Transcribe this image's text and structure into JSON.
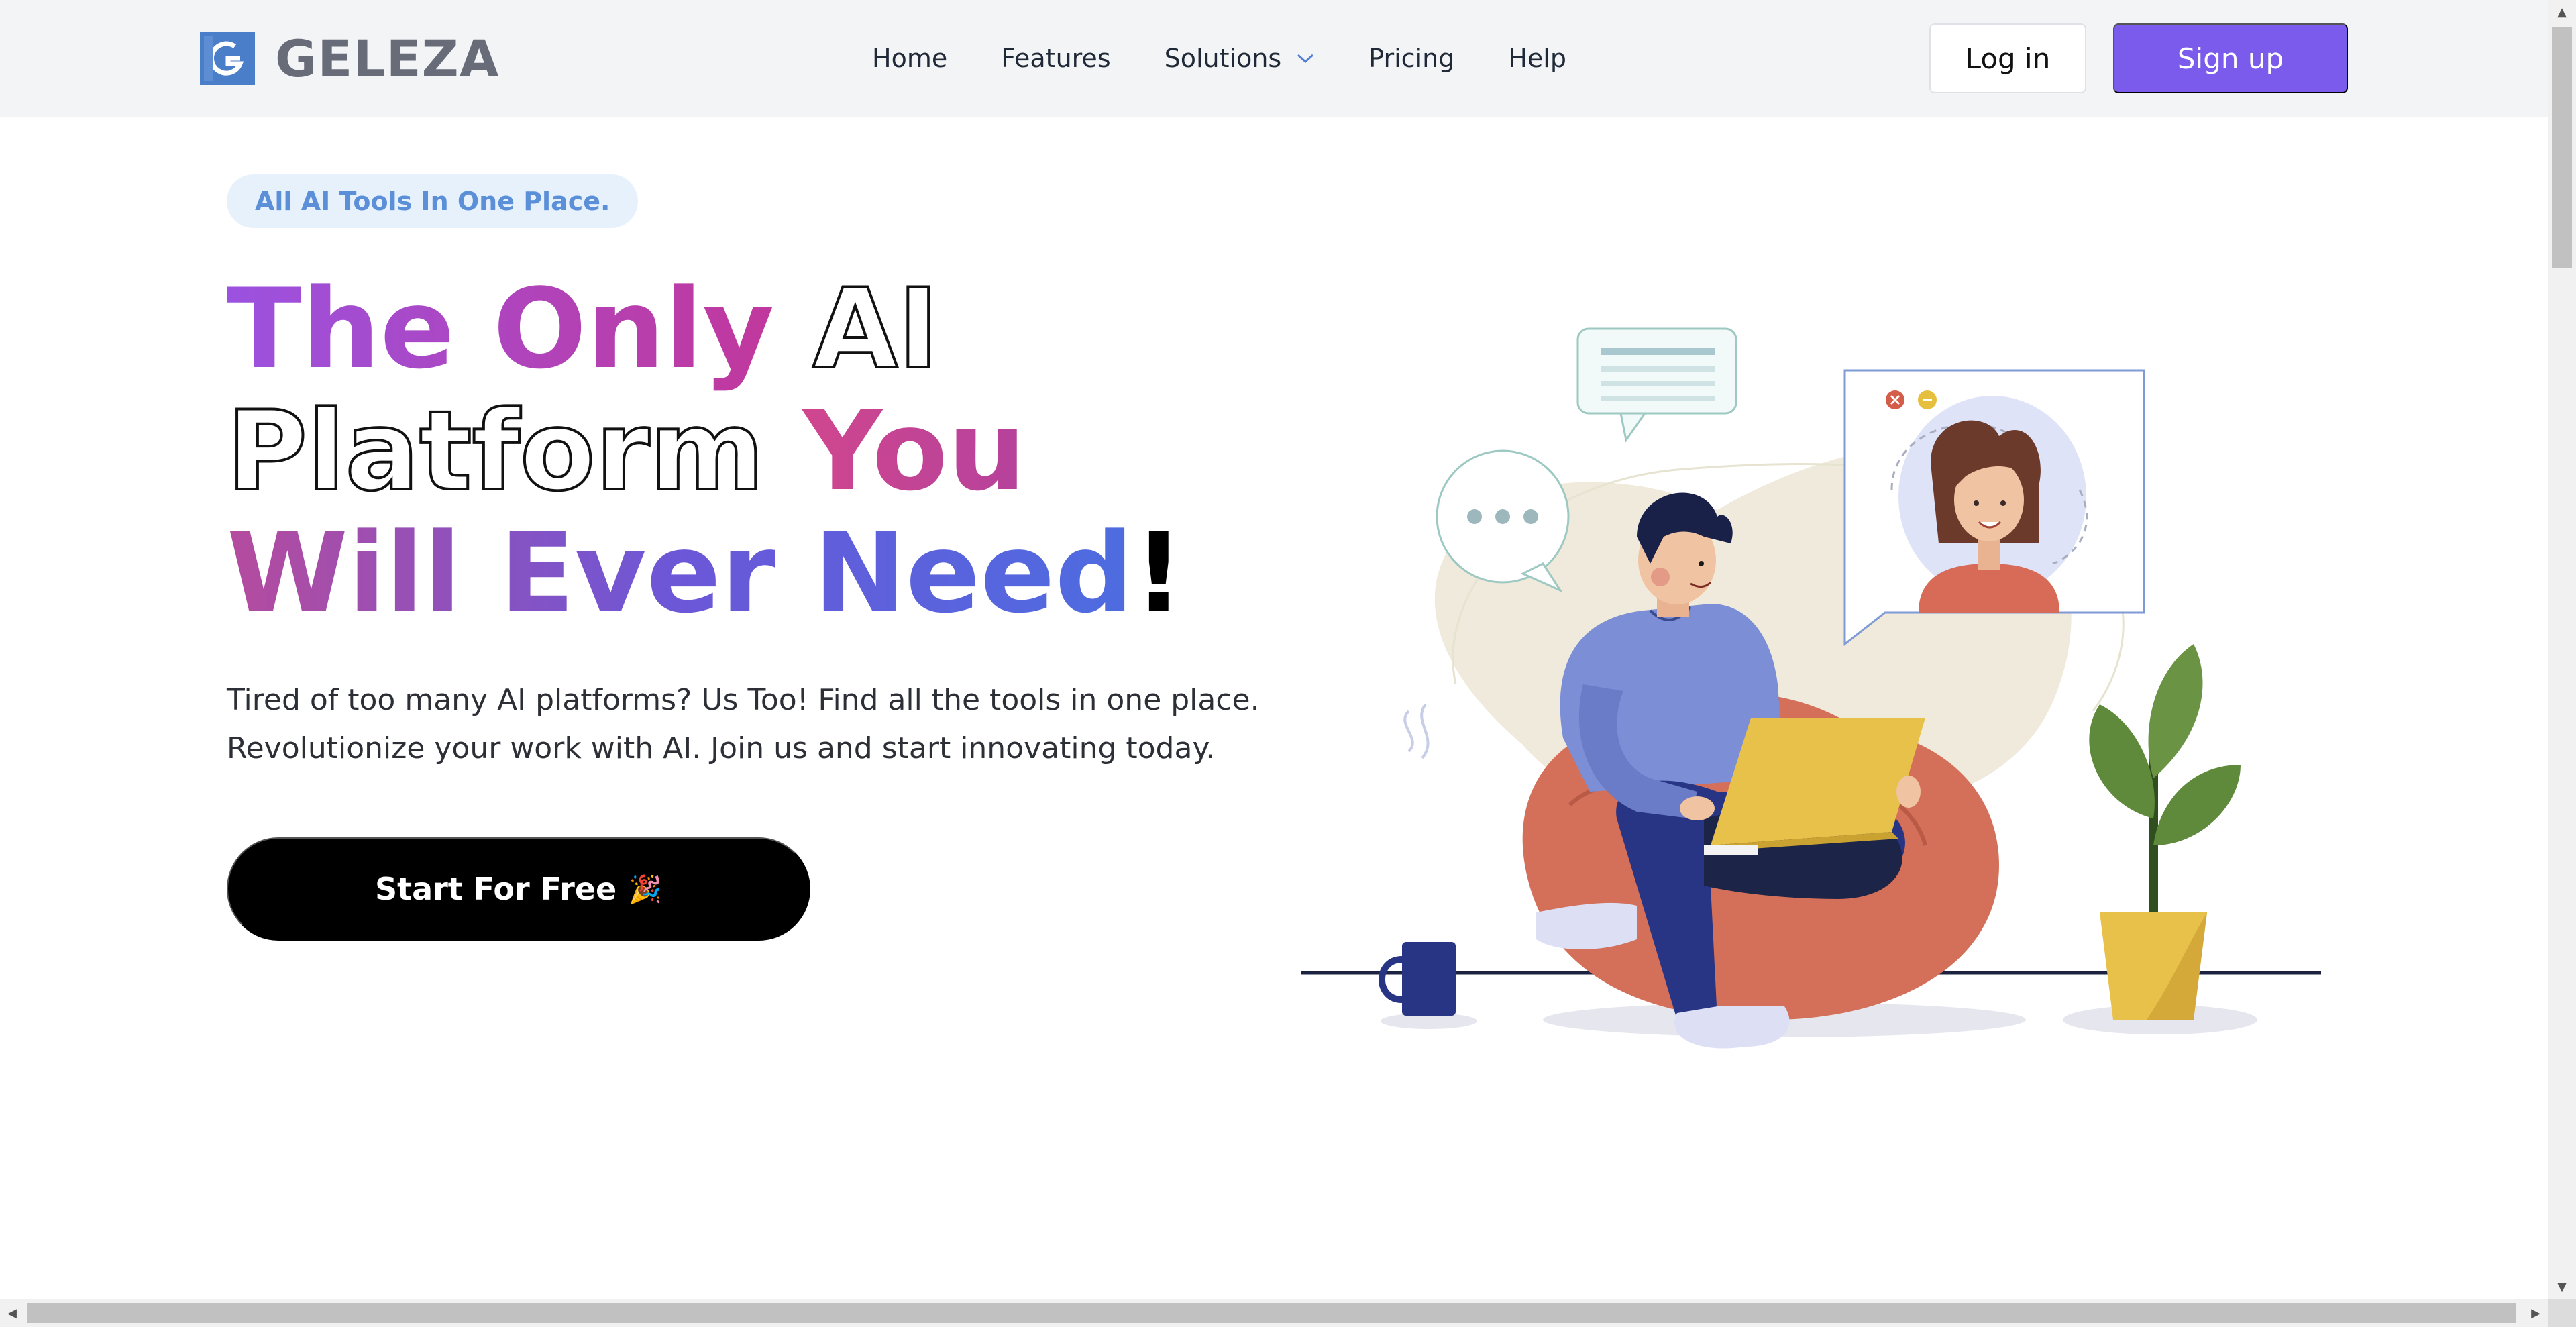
{
  "brand": {
    "name": "GELEZA",
    "accent": "#7a5bec",
    "logo_color": "#4a7ec9"
  },
  "nav": {
    "items": [
      {
        "label": "Home"
      },
      {
        "label": "Features"
      },
      {
        "label": "Solutions",
        "has_dropdown": true
      },
      {
        "label": "Pricing"
      },
      {
        "label": "Help"
      }
    ]
  },
  "auth": {
    "login_label": "Log in",
    "signup_label": "Sign up"
  },
  "hero": {
    "badge": "All AI Tools In One Place.",
    "headline": {
      "line1_a": "The Only",
      "line1_b": "AI",
      "line2_a": "Platform",
      "line2_b": "You",
      "line3_a": "Will Ever Need",
      "line3_b": "!"
    },
    "subtext_line1": "Tired of too many AI platforms? Us Too! Find all the tools in one place.",
    "subtext_line2": "Revolutionize your work with AI. Join us and start innovating today.",
    "cta_label": "Start For Free",
    "cta_emoji": "🎉"
  },
  "illustration": {
    "icons": [
      "chat-bubble-icon",
      "typing-bubble-icon",
      "video-call-window-icon",
      "close-icon",
      "minimize-icon",
      "coffee-mug-icon",
      "plant-icon"
    ]
  }
}
